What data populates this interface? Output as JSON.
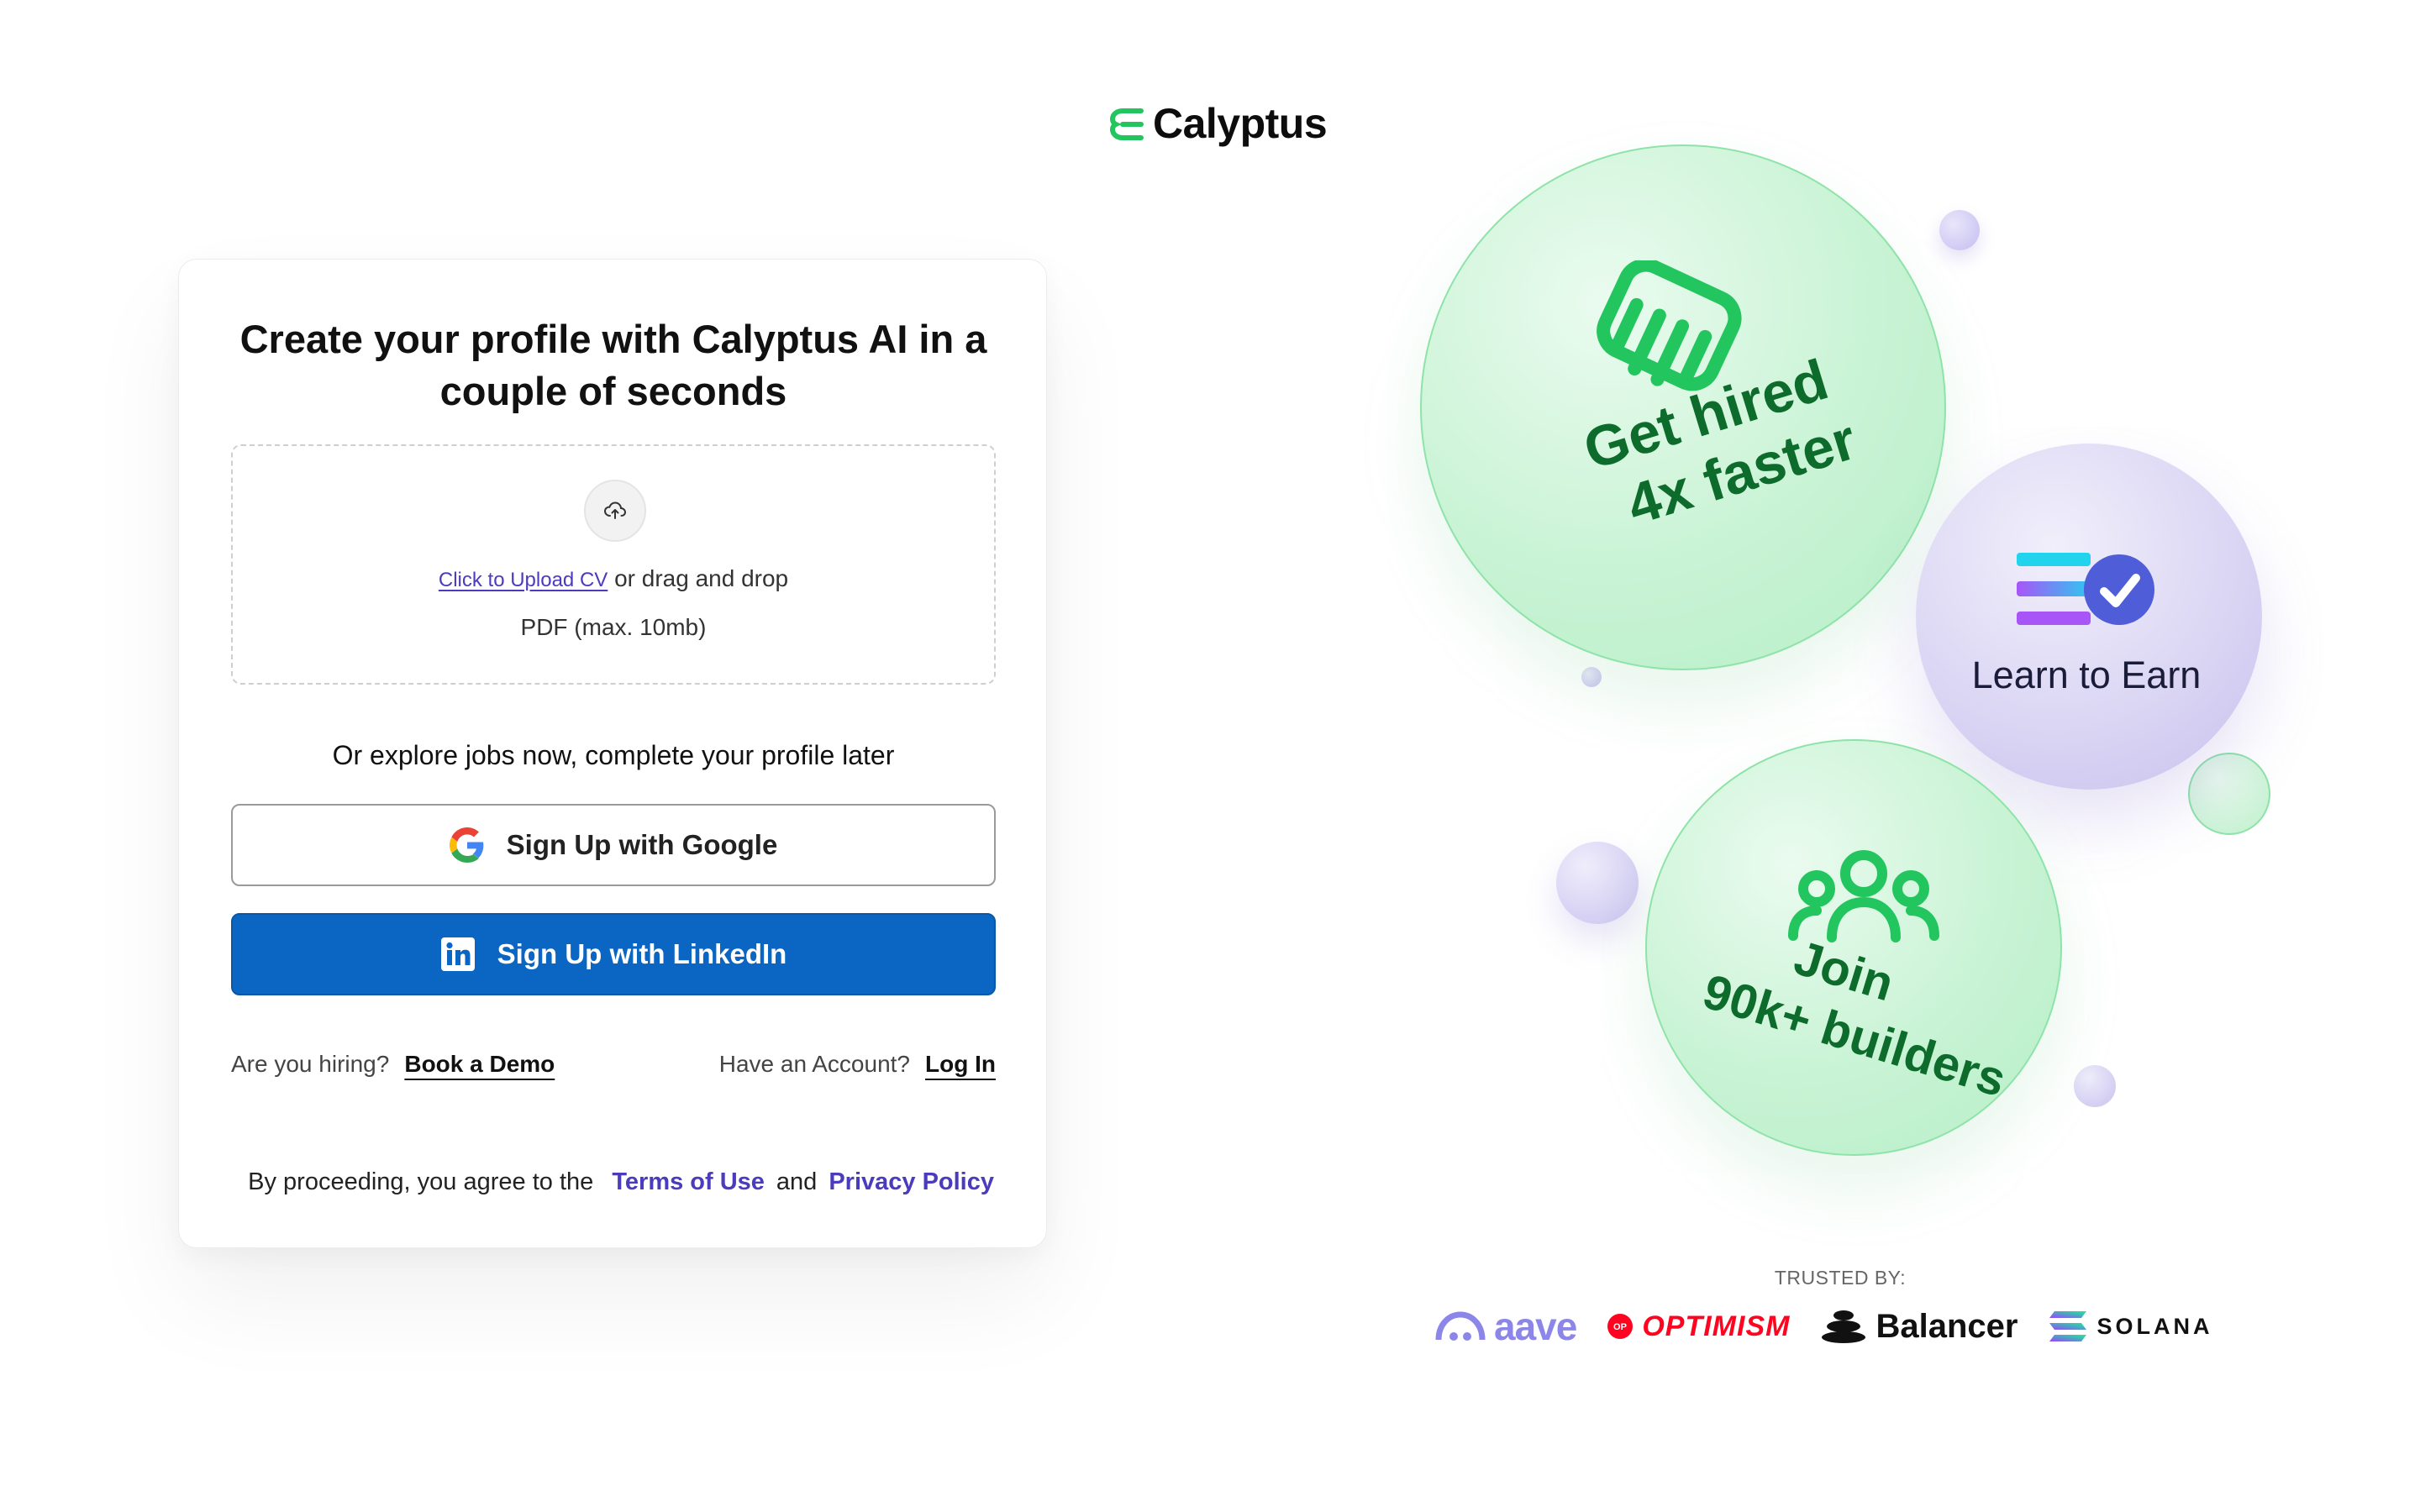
{
  "brand": {
    "name": "Calyptus"
  },
  "card": {
    "title": "Create your profile with Calyptus AI in a couple of seconds",
    "upload": {
      "link_label": "Click to Upload CV",
      "suffix": " or drag and drop",
      "hint": "PDF (max. 10mb)"
    },
    "explore_text": "Or explore jobs now, complete your profile later",
    "google_button": "Sign Up with Google",
    "linkedin_button": "Sign Up with LinkedIn",
    "hiring_question": "Are you hiring?",
    "book_demo": "Book a Demo",
    "account_question": "Have an Account?",
    "login": "Log In",
    "terms_prefix": "By proceeding, you agree to the",
    "terms_link": "Terms of Use",
    "terms_and": "and",
    "privacy_link": "Privacy Policy"
  },
  "bubbles": {
    "hired_line1": "Get hired",
    "hired_line2": "4x faster",
    "earn": "Learn to Earn",
    "join_line1": "Join",
    "join_line2": "90k+ builders"
  },
  "trusted": {
    "label": "TRUSTED BY:",
    "partners": [
      "aave",
      "OPTIMISM",
      "Balancer",
      "SOLANA"
    ],
    "optimism_badge": "OP"
  },
  "colors": {
    "accent_purple": "#4b3bbd",
    "linkedin_blue": "#0a66c2",
    "green_text": "#0d6b2c",
    "brand_green": "#22c55e"
  }
}
